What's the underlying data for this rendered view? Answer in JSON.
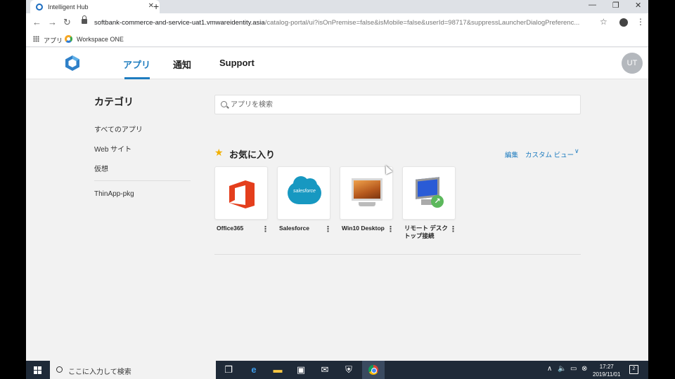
{
  "browser": {
    "tab_title": "Intelligent Hub",
    "tab_close": "✕",
    "new_tab": "+",
    "url_host": "softbank-commerce-and-service-uat1.vmwareidentity.asia",
    "url_path": "/catalog-portal/ui?isOnPremise=false&isMobile=false&userId=98717&suppressLauncherDialogPreferenc...",
    "back": "←",
    "forward": "→",
    "reload": "↻",
    "star": "☆",
    "menu": "⋮",
    "win_min": "—",
    "win_restore": "❐",
    "win_close": "✕",
    "bookmarks": [
      {
        "label": "アプリ",
        "icon": "apps-grid-icon"
      },
      {
        "label": "Workspace ONE",
        "icon": "workspace-one-icon"
      }
    ]
  },
  "hub": {
    "nav": [
      {
        "label": "アプリ",
        "active": true
      },
      {
        "label": "通知",
        "active": false
      },
      {
        "label": "Support",
        "active": false
      }
    ],
    "avatar_initials": "UT",
    "accent_color": "#1e7cbf"
  },
  "sidebar": {
    "title": "カテゴリ",
    "items": [
      "すべてのアプリ",
      "Web サイト",
      "仮想"
    ],
    "items_after_divider": [
      "ThinApp-pkg"
    ]
  },
  "search": {
    "placeholder": "アプリを検索",
    "value": ""
  },
  "favorites": {
    "title": "お気に入り",
    "star_icon": "★",
    "edit_label": "編集",
    "view_label": "カスタム ビュー",
    "view_chevron": "∨",
    "apps": [
      {
        "label": "Office365",
        "icon": "office365-icon"
      },
      {
        "label": "Salesforce",
        "icon": "salesforce-icon",
        "logo_text": "salesforce"
      },
      {
        "label": "Win10 Desktop",
        "icon": "desktop-monitor-icon"
      },
      {
        "label": "リモート デスク\nトップ接続",
        "label_line1": "リモート デスク",
        "label_line2": "トップ接続",
        "icon": "remote-desktop-icon"
      }
    ],
    "kebab": "⋮"
  },
  "taskbar": {
    "search_placeholder": "ここに入力して検索",
    "time": "17:27",
    "date": "2019/11/01",
    "notification_count": "2",
    "tray_up": "∧"
  }
}
